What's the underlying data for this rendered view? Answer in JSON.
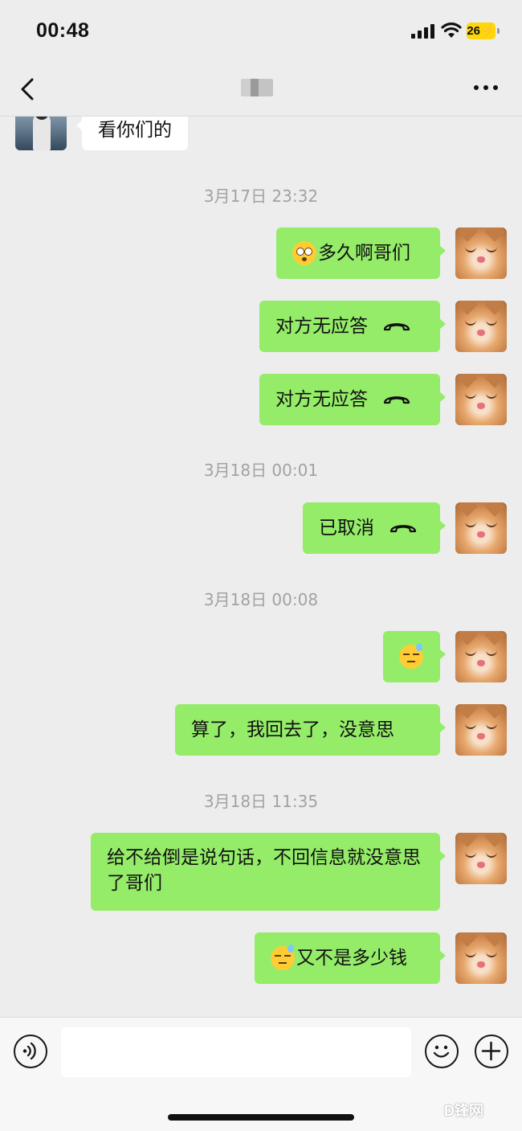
{
  "status_bar": {
    "time": "00:48",
    "battery": "26"
  },
  "nav": {
    "title": "",
    "back_icon": "chevron-left-icon",
    "more_icon": "ellipsis-icon"
  },
  "messages": [
    {
      "sender": "friend",
      "text": "看你们的"
    },
    {
      "type": "time",
      "text": "3月17日 23:32"
    },
    {
      "sender": "me",
      "emoji": "flushed-emoji",
      "text": "多久啊哥们"
    },
    {
      "sender": "me",
      "text": "对方无应答",
      "icon": "phone-hangup-icon"
    },
    {
      "sender": "me",
      "text": "对方无应答",
      "icon": "phone-hangup-icon"
    },
    {
      "type": "time",
      "text": "3月18日 00:01"
    },
    {
      "sender": "me",
      "text": "已取消",
      "icon": "phone-hangup-icon"
    },
    {
      "type": "time",
      "text": "3月18日 00:08"
    },
    {
      "sender": "me",
      "emoji": "downcast-sweat-emoji",
      "text": ""
    },
    {
      "sender": "me",
      "text": "算了，我回去了，没意思"
    },
    {
      "type": "time",
      "text": "3月18日 11:35"
    },
    {
      "sender": "me",
      "text": "给不给倒是说句话，不回信息就没意思了哥们"
    },
    {
      "sender": "me",
      "emoji": "downcast-sweat-emoji",
      "text": "又不是多少钱"
    }
  ],
  "input_bar": {
    "value": "",
    "voice_icon": "voice-icon",
    "emoji_icon": "smiley-icon",
    "plus_icon": "plus-icon"
  },
  "watermark": "D锋网"
}
